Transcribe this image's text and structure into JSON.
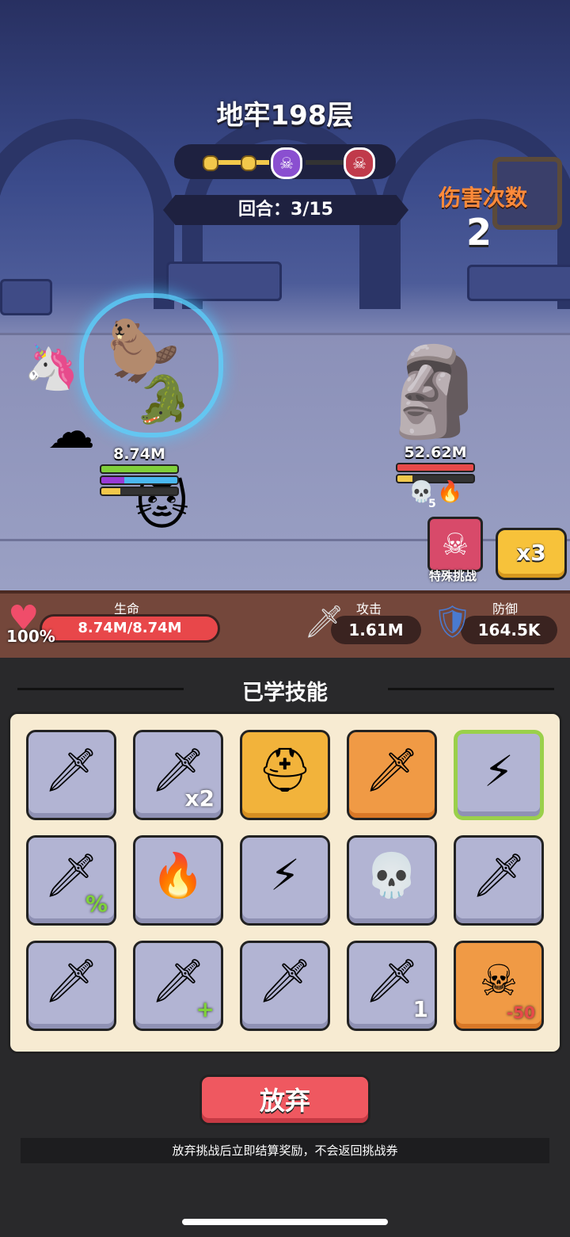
{
  "dungeon": {
    "title": "地牢198层",
    "round_label": "回合：3/15"
  },
  "progress_nodes": [
    "skull-icon",
    "boss-skull-icon"
  ],
  "damage": {
    "label": "伤害次数",
    "count": "2"
  },
  "player": {
    "hp_text": "8.74M"
  },
  "enemy": {
    "hp_text": "52.62M",
    "debuff_count": "5"
  },
  "special_challenge": {
    "label": "特殊挑战"
  },
  "speed_button": {
    "label": "x3"
  },
  "stats": {
    "life_label": "生命",
    "life_value": "8.74M/8.74M",
    "life_percent": "100%",
    "attack_label": "攻击",
    "attack_value": "1.61M",
    "defense_label": "防御",
    "defense_value": "164.5K"
  },
  "skills": {
    "title": "已学技能",
    "items": [
      {
        "icon": "ice-sword-icon",
        "sub": ""
      },
      {
        "icon": "double-sword-icon",
        "sub": "x2"
      },
      {
        "icon": "viking-helmet-icon",
        "sub": ""
      },
      {
        "icon": "dash-sword-icon",
        "sub": ""
      },
      {
        "icon": "lightning-icon",
        "sub": ""
      },
      {
        "icon": "crit-sword-icon",
        "sub": "%"
      },
      {
        "icon": "fire-kunai-icon",
        "sub": ""
      },
      {
        "icon": "lightning-kunai-icon",
        "sub": ""
      },
      {
        "icon": "poison-kunai-icon",
        "sub": ""
      },
      {
        "icon": "flame-sword-icon",
        "sub": ""
      },
      {
        "icon": "kunai-icon",
        "sub": ""
      },
      {
        "icon": "heal-kunai-icon",
        "sub": "+"
      },
      {
        "icon": "frost-sword-icon",
        "sub": ""
      },
      {
        "icon": "golden-dagger-icon",
        "sub": "1"
      },
      {
        "icon": "skull-burn-icon",
        "sub": "-50"
      }
    ]
  },
  "abandon": {
    "label": "放弃",
    "notice": "放弃挑战后立即结算奖励，不会返回挑战券"
  }
}
